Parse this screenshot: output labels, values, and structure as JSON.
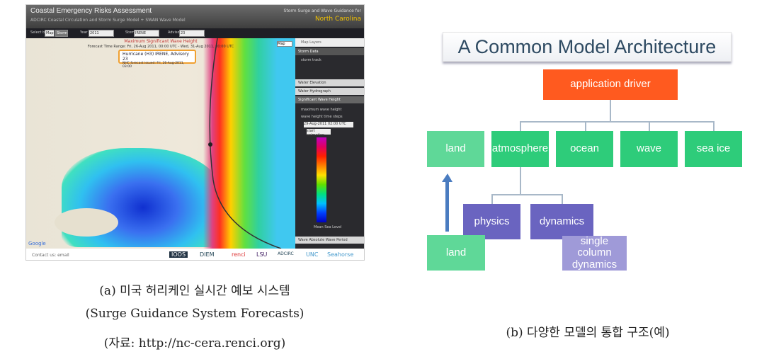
{
  "left_panel": {
    "header": {
      "title": "Coastal Emergency Risks Assessment",
      "subtitle": "ADCIRC Coastal Circulation and Storm Surge Model + SWAN Wave Model",
      "right_line1": "Storm Surge and Wave Guidance for",
      "right_line2": "North Carolina"
    },
    "toolbar": {
      "select_by": "Select by",
      "map_btn": "Map",
      "storm_btn": "Storm",
      "year_label": "Year",
      "year": "2011",
      "storm_label": "Storm",
      "storm": "IRENE",
      "advisory_label": "Advisory",
      "advisory": "23"
    },
    "map": {
      "title": "Maximum Significant Wave Height",
      "range": "Forecast Time Range: Fri, 26-Aug 2011, 00:00 UTC - Wed, 31-Aug 2011, 00:00 UTC",
      "hurricane": "Hurricane (H3) IRENE, Advisory 23",
      "issued": "NHC forecast issued: Fri, 26-Aug-2011, 03:00",
      "map_type": "Map",
      "google": "Google"
    },
    "sidebar": {
      "title": "Map Layers",
      "storm_data": "Storm Data",
      "storm_track": "storm track",
      "water_elevation": "Water Elevation",
      "water_hydrograph": "Water Hydrograph",
      "sig_wave": "Significant Wave Height",
      "max_wave": "maximum wave height",
      "time_steps": "wave height time steps",
      "date": "29-Aug-2011 02:00 UTC",
      "animation": "start animation",
      "sea_level": "Mean Sea Level",
      "max_abs": "Wave Absolute Wave Period"
    },
    "footer": {
      "contact": "Contact us: email",
      "logos": [
        "IOOS",
        "DIEM",
        "renci",
        "LSU",
        "ADCIRC",
        "UNC",
        "Seahorse"
      ]
    }
  },
  "captions": {
    "a_line1": "(a) 미국 허리케인 실시간 예보 시스템",
    "a_line2": "(Surge Guidance System Forecasts)",
    "a_line3": "(자료: http://nc-cera.renci.org)",
    "b": "(b) 다양한 모델의 통합 구조(예)"
  },
  "diagram": {
    "title": "A Common Model Architecture",
    "driver": "application driver",
    "components": [
      "land",
      "atmosphere",
      "ocean",
      "wave",
      "sea ice"
    ],
    "sub": [
      "physics",
      "dynamics"
    ],
    "single": "single column dynamics",
    "land_bottom": "land",
    "colors": {
      "driver": "#ff5a1f",
      "component": "#2ecc7a",
      "sub": "#6a64c0"
    }
  }
}
